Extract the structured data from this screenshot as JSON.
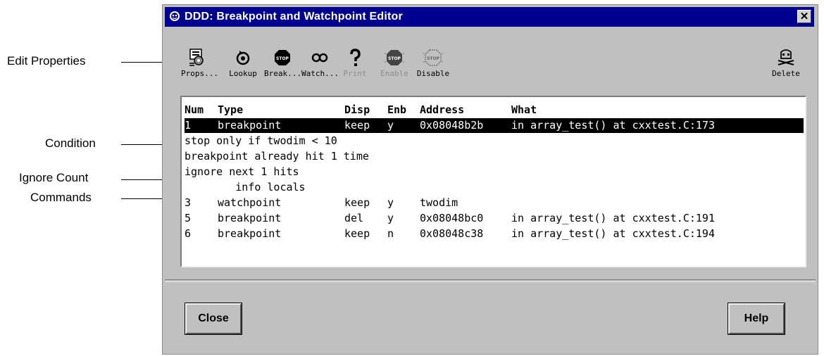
{
  "annotations": {
    "edit_properties": "Edit Properties",
    "condition": "Condition",
    "ignore_count": "Ignore Count",
    "commands": "Commands"
  },
  "window": {
    "title": "DDD: Breakpoint and Watchpoint Editor",
    "close_glyph": "✕"
  },
  "toolbar": {
    "buttons": [
      {
        "label": "Props...",
        "icon": "props-icon",
        "enabled": true
      },
      {
        "label": "Lookup",
        "icon": "lookup-icon",
        "enabled": true
      },
      {
        "label": "Break...",
        "icon": "stop-sign-icon",
        "enabled": true
      },
      {
        "label": "Watch...",
        "icon": "glasses-icon",
        "enabled": true
      },
      {
        "label": "Print",
        "icon": "question-mark-icon",
        "enabled": false
      },
      {
        "label": "Enable",
        "icon": "stop-sign-icon",
        "enabled": false
      },
      {
        "label": "Disable",
        "icon": "stop-sign-disabled-icon",
        "enabled": true
      },
      {
        "label": "Delete",
        "icon": "skull-icon",
        "enabled": true
      }
    ]
  },
  "table": {
    "headers": {
      "num": "Num",
      "type": "Type",
      "disp": "Disp",
      "enb": "Enb",
      "address": "Address",
      "what": "What"
    },
    "rows": [
      {
        "num": "1",
        "type": "breakpoint",
        "disp": "keep",
        "enb": "y",
        "address": "0x08048b2b",
        "what": "in array_test() at cxxtest.C:173"
      },
      {
        "text": "stop only if twodim < 10"
      },
      {
        "text": "breakpoint already hit 1 time"
      },
      {
        "text": "ignore next 1 hits"
      },
      {
        "text": "        info locals"
      },
      {
        "num": "3",
        "type": "watchpoint",
        "disp": "keep",
        "enb": "y",
        "address": "twodim",
        "what": ""
      },
      {
        "num": "5",
        "type": "breakpoint",
        "disp": "del",
        "enb": "y",
        "address": "0x08048bc0",
        "what": "in array_test() at cxxtest.C:191"
      },
      {
        "num": "6",
        "type": "breakpoint",
        "disp": "keep",
        "enb": "n",
        "address": "0x08048c38",
        "what": "in array_test() at cxxtest.C:194"
      }
    ]
  },
  "buttons": {
    "close": "Close",
    "help": "Help"
  },
  "stop_sign_text": "STOP"
}
